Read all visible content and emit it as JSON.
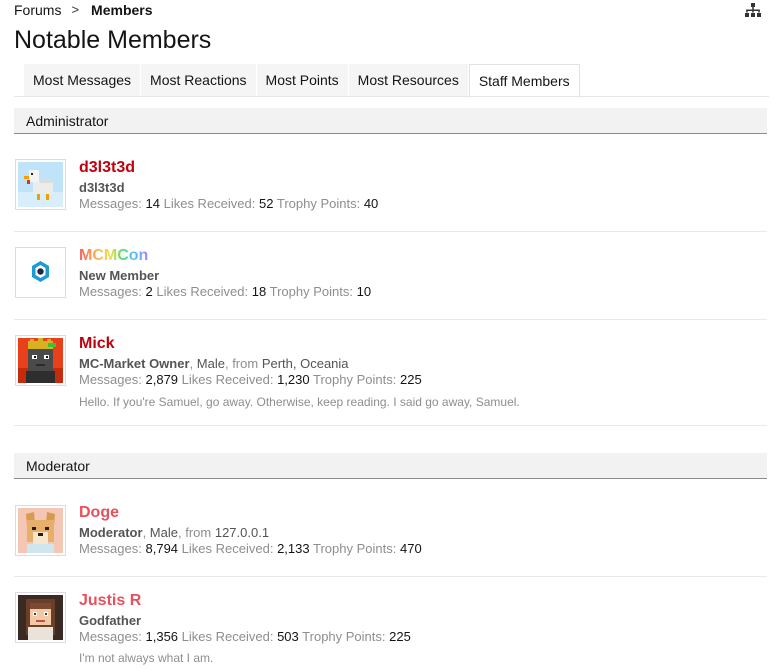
{
  "breadcrumb": {
    "forums": "Forums",
    "separator": ">",
    "current": "Members"
  },
  "page_title": "Notable Members",
  "tabs": [
    {
      "label": "Most Messages",
      "active": false
    },
    {
      "label": "Most Reactions",
      "active": false
    },
    {
      "label": "Most Points",
      "active": false
    },
    {
      "label": "Most Resources",
      "active": false
    },
    {
      "label": "Staff Members",
      "active": true
    }
  ],
  "stat_labels": {
    "messages": "Messages:",
    "likes": "Likes Received:",
    "points": "Trophy Points:"
  },
  "sections": [
    {
      "title": "Administrator",
      "members": [
        {
          "name": "d3l3t3d",
          "title": "d3l3t3d",
          "messages": "14",
          "likes": "52",
          "points": "40"
        },
        {
          "name": "MCMCon",
          "title": "New Member",
          "messages": "2",
          "likes": "18",
          "points": "10"
        },
        {
          "name": "Mick",
          "title": "MC-Market Owner",
          "gender": "Male",
          "from_label": "from",
          "location": "Perth, Oceania",
          "messages": "2,879",
          "likes": "1,230",
          "points": "225",
          "signature": "Hello. If you're Samuel, go away. Otherwise, keep reading. I said go away, Samuel."
        }
      ]
    },
    {
      "title": "Moderator",
      "members": [
        {
          "name": "Doge",
          "title": "Moderator",
          "gender": "Male",
          "from_label": "from",
          "location": "127.0.0.1",
          "messages": "8,794",
          "likes": "2,133",
          "points": "470"
        },
        {
          "name": "Justis R",
          "title": "Godfather",
          "messages": "1,356",
          "likes": "503",
          "points": "225",
          "signature": "I'm not always what I am."
        }
      ]
    }
  ],
  "colors": {
    "admin_name": "#c1000e",
    "moderator_name": "#e8505b",
    "section_bg": "#f2f2f2"
  }
}
